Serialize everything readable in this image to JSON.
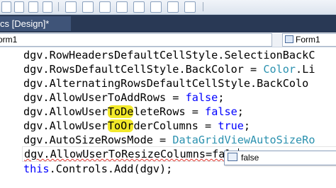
{
  "document_tab": {
    "title": "cs [Design]*"
  },
  "navigation": {
    "left_selector": "orm1",
    "right_selector": "Form1"
  },
  "code": {
    "lines": [
      {
        "prefix": "dgv.RowHeadersDefaultCellStyle.SelectionBack",
        "suffix": "C"
      },
      {
        "prefix": "dgv.RowsDefaultCellStyle.BackColor = ",
        "type": "Color",
        "rest": ".Li"
      },
      {
        "text": "dgv.AlternatingRowsDefaultCellStyle.BackColo"
      },
      {
        "prefix": "dgv.AllowUserToAddRows = ",
        "keyword": "false",
        "suffix": ";"
      },
      {
        "a": "dgv.AllowUser",
        "h": "ToDe",
        "b": "leteRows = ",
        "keyword": "false",
        "suffix": ";"
      },
      {
        "a": "dgv.AllowUser",
        "h": "ToOr",
        "b": "derColumns = ",
        "keyword": "true",
        "suffix": ";"
      },
      {
        "prefix": "dgv.AutoSizeRowsMode = ",
        "type": "DataGridViewAutoSizeRo"
      },
      {
        "text": "dgv.AllowUserToResizeColumns=fals"
      },
      {
        "prefix": "",
        "keyword": "this",
        "suffix": ".Controls.Add(dgv);"
      }
    ]
  },
  "intellisense": {
    "item": "false"
  },
  "colors": {
    "keyword": "#0000ff",
    "type": "#2b91af",
    "highlight": "#f2e92a",
    "tab_background": "#293955"
  }
}
